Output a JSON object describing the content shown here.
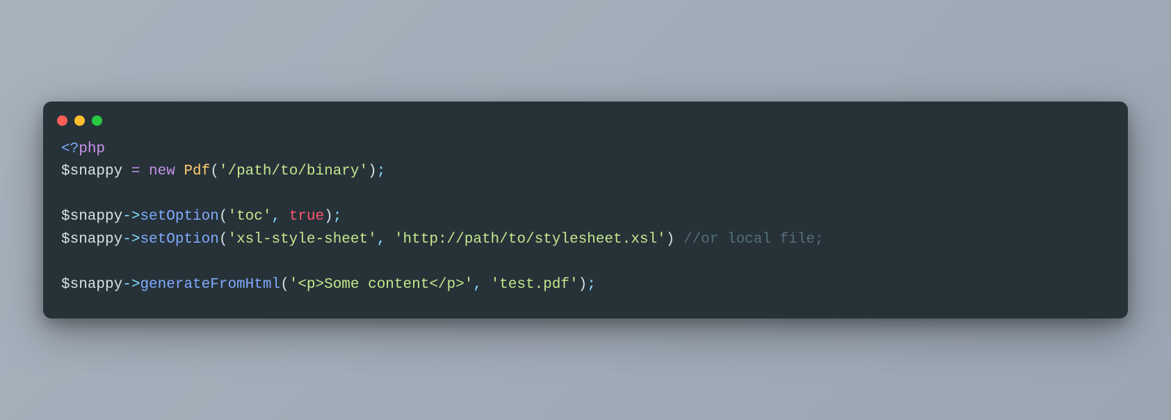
{
  "code": {
    "line1": {
      "open1": "<?",
      "open2": "php"
    },
    "line2": {
      "var": "$snappy",
      "eq": " = ",
      "kw_new": "new",
      "sp": " ",
      "cls": "Pdf",
      "lp": "(",
      "str": "'/path/to/binary'",
      "rp": ")",
      "semi": ";"
    },
    "line4": {
      "var": "$snappy",
      "arrow": "->",
      "method": "setOption",
      "lp": "(",
      "arg1": "'toc'",
      "comma": ",",
      "sp": " ",
      "arg2": "true",
      "rp": ")",
      "semi": ";"
    },
    "line5": {
      "var": "$snappy",
      "arrow": "->",
      "method": "setOption",
      "lp": "(",
      "arg1": "'xsl-style-sheet'",
      "comma": ",",
      "sp": " ",
      "arg2": "'http://path/to/stylesheet.xsl'",
      "rp": ")",
      "sp2": " ",
      "comment": "//or local file;"
    },
    "line7": {
      "var": "$snappy",
      "arrow": "->",
      "method": "generateFromHtml",
      "lp": "(",
      "arg1": "'<p>Some content</p>'",
      "comma": ",",
      "sp": " ",
      "arg2": "'test.pdf'",
      "rp": ")",
      "semi": ";"
    }
  }
}
